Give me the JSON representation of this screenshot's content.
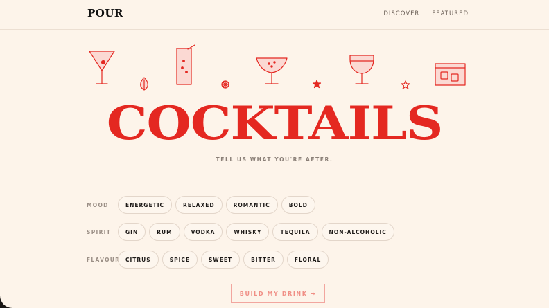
{
  "brand": {
    "logo": "POUR"
  },
  "nav": {
    "discover": "DISCOVER",
    "featured": "FEATURED"
  },
  "hero": {
    "title": "COCKTAILS",
    "tagline": "TELL US WHAT YOU'RE AFTER."
  },
  "filters": {
    "mood": {
      "label": "MOOD",
      "options": [
        "ENERGETIC",
        "RELAXED",
        "ROMANTIC",
        "BOLD"
      ]
    },
    "spirit": {
      "label": "SPIRIT",
      "options": [
        "GIN",
        "RUM",
        "VODKA",
        "WHISKY",
        "TEQUILA",
        "NON-ALCOHOLIC"
      ]
    },
    "flavour": {
      "label": "FLAVOUR",
      "options": [
        "CITRUS",
        "SPICE",
        "SWEET",
        "BITTER",
        "FLORAL"
      ]
    }
  },
  "cta": {
    "label": "BUILD MY DRINK →"
  },
  "icons": [
    "martini-glass-icon",
    "leaf-icon",
    "highball-glass-icon",
    "citrus-slice-icon",
    "coupe-glass-icon",
    "star-icon",
    "wine-glass-icon",
    "star-outline-icon",
    "rocks-glass-icon"
  ],
  "colors": {
    "accent": "#e42821",
    "background": "#fdf4ea",
    "cta": "#f08f86"
  }
}
